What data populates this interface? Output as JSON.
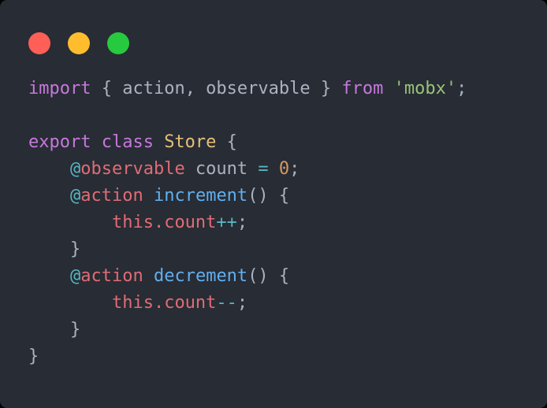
{
  "card": {
    "background_color": "#282c34",
    "corner_radius_px": 9
  },
  "window_controls": [
    {
      "name": "close",
      "color": "#ff5f56"
    },
    {
      "name": "minimize",
      "color": "#ffbd2e"
    },
    {
      "name": "zoom",
      "color": "#27c93f"
    }
  ],
  "theme": {
    "name": "One Dark",
    "plain": "#abb2bf",
    "keyword": "#c678dd",
    "string": "#98c379",
    "class_name": "#e5c07b",
    "operator": "#56b6c2",
    "decorator": "#e06c75",
    "property": "#e06c75",
    "function": "#61afef",
    "number": "#d19a66"
  },
  "code": {
    "language": "javascript",
    "full_text": "import { action, observable } from 'mobx';\n\nexport class Store {\n    @observable count = 0;\n    @action increment() {\n        this.count++;\n    }\n    @action decrement() {\n        this.count--;\n    }\n}",
    "lines": [
      {
        "index": 1,
        "text": "import { action, observable } from 'mobx';",
        "tokens": [
          {
            "t": "import",
            "c": "keyword"
          },
          {
            "t": " { action, observable } ",
            "c": "plain"
          },
          {
            "t": "from",
            "c": "keyword"
          },
          {
            "t": " ",
            "c": "plain"
          },
          {
            "t": "'mobx'",
            "c": "string"
          },
          {
            "t": ";",
            "c": "punct"
          }
        ]
      },
      {
        "index": 2,
        "text": "",
        "tokens": []
      },
      {
        "index": 3,
        "text": "export class Store {",
        "tokens": [
          {
            "t": "export class ",
            "c": "keyword"
          },
          {
            "t": "Store",
            "c": "class"
          },
          {
            "t": " {",
            "c": "punct"
          }
        ]
      },
      {
        "index": 4,
        "text": "    @observable count = 0;",
        "tokens": [
          {
            "t": "    ",
            "c": "plain"
          },
          {
            "t": "@",
            "c": "operator"
          },
          {
            "t": "observable",
            "c": "decorator"
          },
          {
            "t": " count ",
            "c": "plain"
          },
          {
            "t": "=",
            "c": "operator"
          },
          {
            "t": " ",
            "c": "plain"
          },
          {
            "t": "0",
            "c": "number"
          },
          {
            "t": ";",
            "c": "punct"
          }
        ]
      },
      {
        "index": 5,
        "text": "    @action increment() {",
        "tokens": [
          {
            "t": "    ",
            "c": "plain"
          },
          {
            "t": "@",
            "c": "operator"
          },
          {
            "t": "action",
            "c": "decorator"
          },
          {
            "t": " ",
            "c": "plain"
          },
          {
            "t": "increment",
            "c": "function"
          },
          {
            "t": "() {",
            "c": "punct"
          }
        ]
      },
      {
        "index": 6,
        "text": "        this.count++;",
        "tokens": [
          {
            "t": "        ",
            "c": "plain"
          },
          {
            "t": "this.count",
            "c": "property"
          },
          {
            "t": "++",
            "c": "operator"
          },
          {
            "t": ";",
            "c": "punct"
          }
        ]
      },
      {
        "index": 7,
        "text": "    }",
        "tokens": [
          {
            "t": "    ",
            "c": "plain"
          },
          {
            "t": "}",
            "c": "punct"
          }
        ]
      },
      {
        "index": 8,
        "text": "    @action decrement() {",
        "tokens": [
          {
            "t": "    ",
            "c": "plain"
          },
          {
            "t": "@",
            "c": "operator"
          },
          {
            "t": "action",
            "c": "decorator"
          },
          {
            "t": " ",
            "c": "plain"
          },
          {
            "t": "decrement",
            "c": "function"
          },
          {
            "t": "() {",
            "c": "punct"
          }
        ]
      },
      {
        "index": 9,
        "text": "        this.count--;",
        "tokens": [
          {
            "t": "        ",
            "c": "plain"
          },
          {
            "t": "this.count",
            "c": "property"
          },
          {
            "t": "--",
            "c": "operator"
          },
          {
            "t": ";",
            "c": "punct"
          }
        ]
      },
      {
        "index": 10,
        "text": "    }",
        "tokens": [
          {
            "t": "    ",
            "c": "plain"
          },
          {
            "t": "}",
            "c": "punct"
          }
        ]
      },
      {
        "index": 11,
        "text": "}",
        "tokens": [
          {
            "t": "}",
            "c": "punct"
          }
        ]
      }
    ]
  }
}
